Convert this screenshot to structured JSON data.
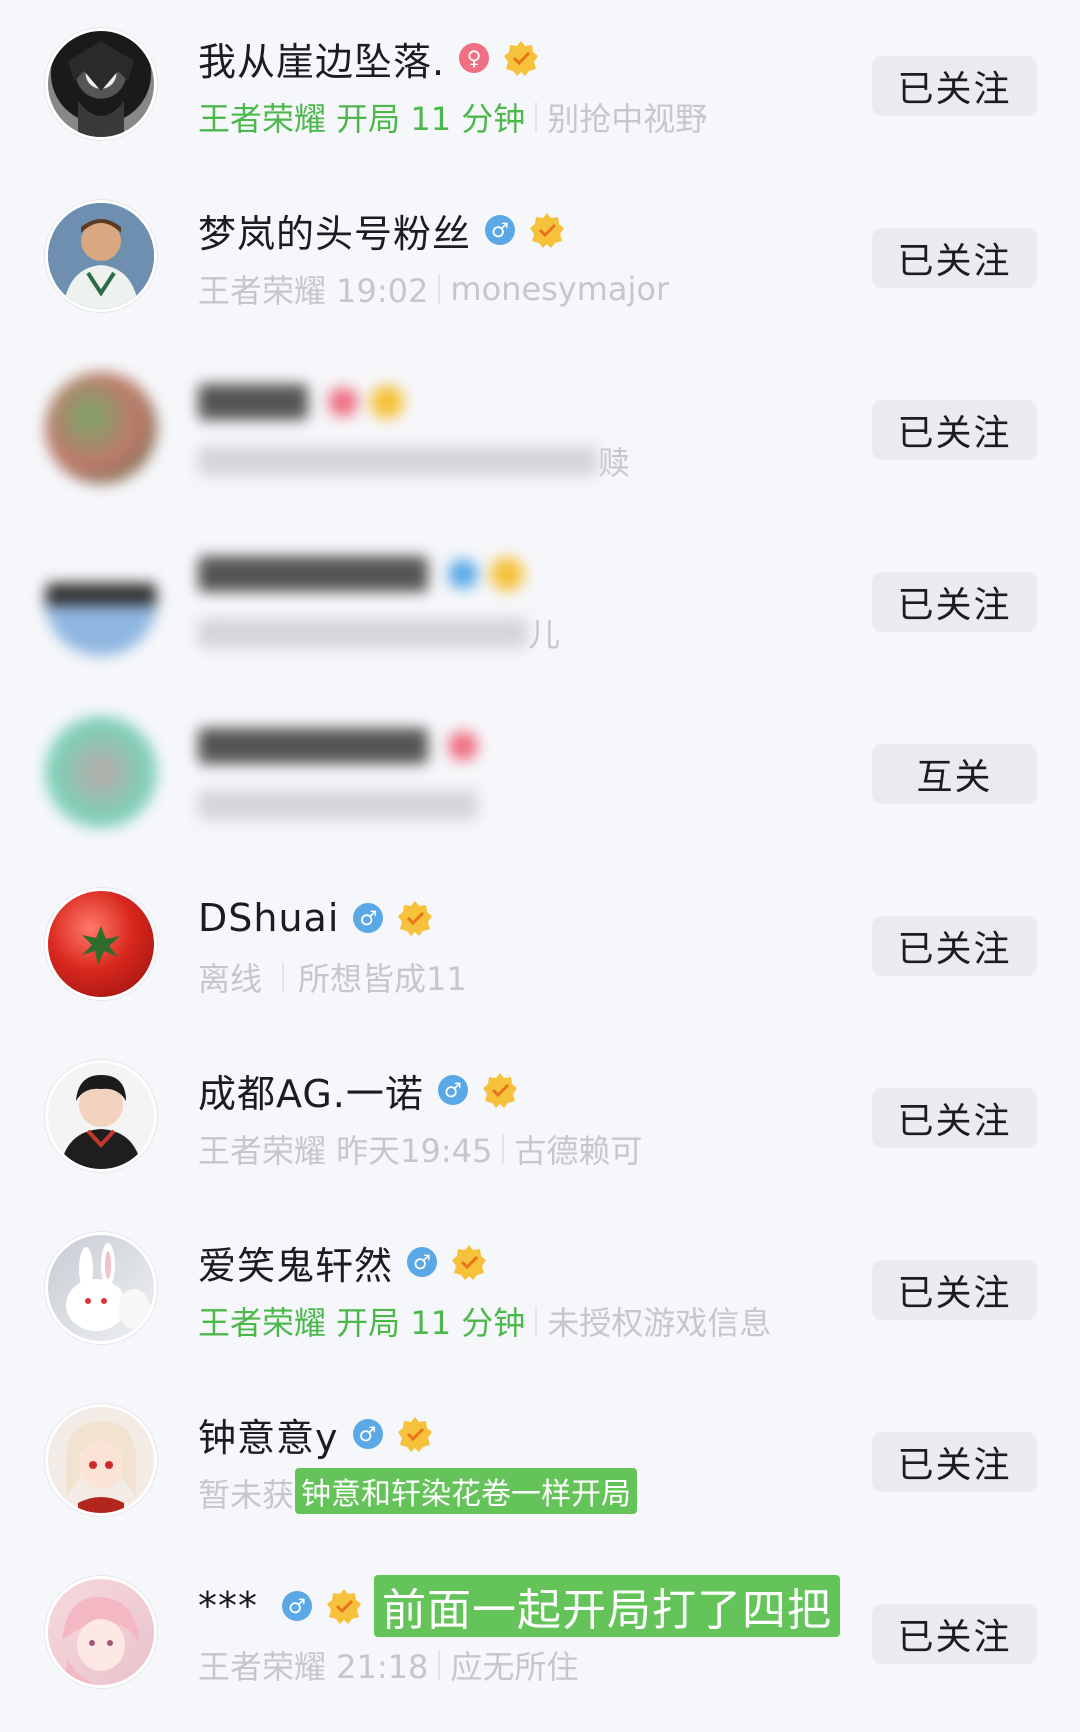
{
  "rows": [
    {
      "name": "我从崖边坠落.",
      "gender": "♀",
      "status": "王者荣耀  开局 11 分钟",
      "signature": "别抢中视野",
      "button": "已关注"
    },
    {
      "name": "梦岚的头号粉丝",
      "gender": "♂",
      "status": "王者荣耀 19:02",
      "signature": "monesymajor",
      "button": "已关注"
    },
    {
      "name": "",
      "gender": "",
      "status": "",
      "signature": "赎",
      "button": "已关注"
    },
    {
      "name": "",
      "gender": "",
      "status": "",
      "signature": "儿",
      "button": "已关注"
    },
    {
      "name": "",
      "gender": "",
      "status": "",
      "signature": "",
      "button": "互关"
    },
    {
      "name": "DShuai",
      "gender": "♂",
      "status": "离线",
      "signature": "所想皆成11",
      "button": "已关注"
    },
    {
      "name": "成都AG.一诺",
      "gender": "♂",
      "status": "王者荣耀 昨天19:45",
      "signature": "古德赖可",
      "button": "已关注"
    },
    {
      "name": "爱笑鬼轩然",
      "gender": "♂",
      "status": "王者荣耀  开局 11 分钟",
      "signature": "未授权游戏信息",
      "button": "已关注"
    },
    {
      "name": "钟意意y",
      "gender": "♂",
      "status": "暂未获",
      "signature": "",
      "button": "已关注"
    },
    {
      "name": "***",
      "gender": "♂",
      "status": "王者荣耀 21:18",
      "signature": "应无所住",
      "button": "已关注"
    }
  ],
  "overlays": {
    "row9_caption": "钟意和轩染花卷一样开局",
    "row10_caption": "前面一起开局打了四把"
  },
  "colors": {
    "background": "#f6f7fa",
    "active_status": "#4cb84c",
    "male_badge": "#5aa9e6",
    "female_badge": "#ef6f83",
    "verified_badge": "#f6c13b",
    "overlay_green": "#64c45a",
    "button_bg": "#e9ebf0"
  },
  "icons": {
    "female": "female-icon",
    "male": "male-icon",
    "verified": "verified-badge-icon"
  }
}
